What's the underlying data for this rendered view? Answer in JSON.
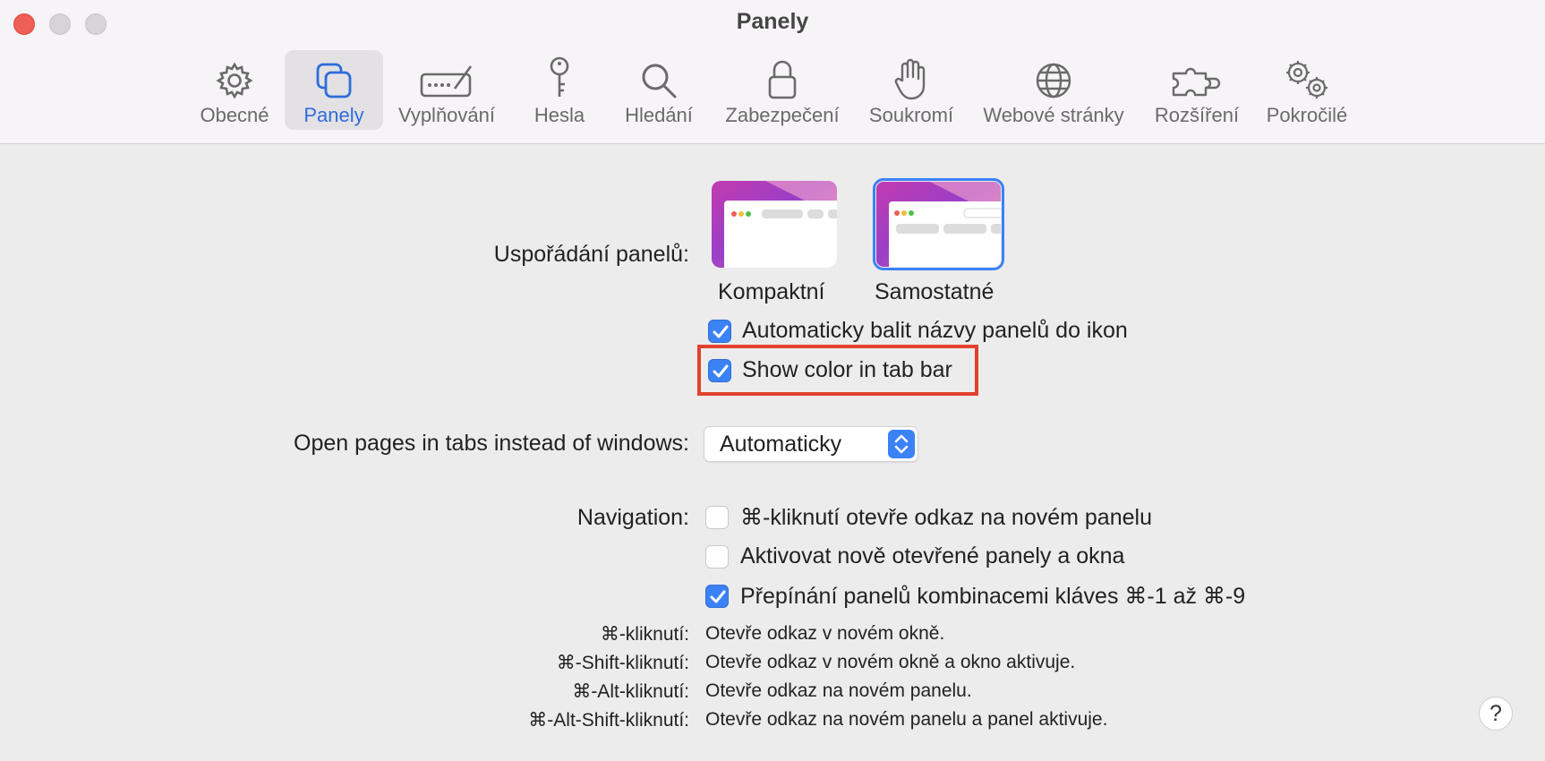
{
  "window": {
    "title": "Panely"
  },
  "toolbar": {
    "items": [
      {
        "label": "Obecné",
        "icon": "gear-icon",
        "active": false
      },
      {
        "label": "Panely",
        "icon": "tabs-icon",
        "active": true
      },
      {
        "label": "Vyplňování",
        "icon": "autofill-icon",
        "active": false
      },
      {
        "label": "Hesla",
        "icon": "key-icon",
        "active": false
      },
      {
        "label": "Hledání",
        "icon": "search-icon",
        "active": false
      },
      {
        "label": "Zabezpečení",
        "icon": "lock-icon",
        "active": false
      },
      {
        "label": "Soukromí",
        "icon": "hand-icon",
        "active": false
      },
      {
        "label": "Webové stránky",
        "icon": "globe-icon",
        "active": false
      },
      {
        "label": "Rozšíření",
        "icon": "puzzle-icon",
        "active": false
      },
      {
        "label": "Pokročilé",
        "icon": "advanced-gears-icon",
        "active": false
      }
    ]
  },
  "tab_layout": {
    "label": "Uspořádání panelů:",
    "options": [
      {
        "label": "Kompaktní",
        "selected": false
      },
      {
        "label": "Samostatné",
        "selected": true
      }
    ]
  },
  "checkboxes": {
    "auto_icons": {
      "label": "Automaticky balit názvy panelů do ikon",
      "checked": true
    },
    "show_color": {
      "label": "Show color in tab bar",
      "checked": true
    }
  },
  "open_pages": {
    "label": "Open pages in tabs instead of windows:",
    "value": "Automaticky"
  },
  "navigation": {
    "label": "Navigation:",
    "options": [
      {
        "label": "⌘-kliknutí otevře odkaz na novém panelu",
        "checked": false
      },
      {
        "label": "Aktivovat nově otevřené panely a okna",
        "checked": false
      },
      {
        "label": "Přepínání panelů kombinacemi kláves ⌘-1 až ⌘-9",
        "checked": true
      }
    ]
  },
  "shortcuts": [
    {
      "key": "⌘-kliknutí:",
      "desc": "Otevře odkaz v novém okně."
    },
    {
      "key": "⌘-Shift-kliknutí:",
      "desc": "Otevře odkaz v novém okně a okno aktivuje."
    },
    {
      "key": "⌘-Alt-kliknutí:",
      "desc": "Otevře odkaz na novém panelu."
    },
    {
      "key": "⌘-Alt-Shift-kliknutí:",
      "desc": "Otevře odkaz na novém panelu a panel aktivuje."
    }
  ],
  "help": {
    "label": "?"
  },
  "colors": {
    "accent": "#3a82f6",
    "highlight": "#e2412d",
    "active_label": "#2e6ddb"
  }
}
